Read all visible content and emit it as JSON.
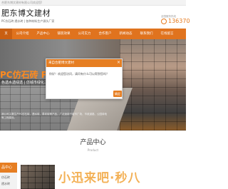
{
  "topbar": {
    "text": "合肥东博文建材有限公司欢迎您!"
  },
  "header": {
    "logo_title": "肥东博文建材",
    "logo_subtitle": "PC仿石砖·透水砖 | 各种材料生产源头厂家",
    "hotline_label": "全国服务热线",
    "phone": "136370"
  },
  "nav": {
    "items": [
      {
        "label": "页"
      },
      {
        "label": "公司介绍"
      },
      {
        "label": "产品中心"
      },
      {
        "label": "铺装效果"
      },
      {
        "label": "公司实力"
      },
      {
        "label": "合作客户"
      },
      {
        "label": "新闻动态"
      },
      {
        "label": "联系我们"
      },
      {
        "label": "在线留言"
      }
    ]
  },
  "banner": {
    "title": "PC仿石砖 PC",
    "subtitle": "色透水透绿透 | 仿城市绿化工程管家",
    "body": "我公司主要生产PC仿石砖，透水砖，草坪砖等产品，广泛适用于城市广场、市政道路、公园绿地等工程建设。"
  },
  "dialog": {
    "title": "来自合肥博文建材",
    "close": "×",
    "message": "你好！欢迎您访问，请问有什么可以帮到您吗？",
    "confirm": "确定"
  },
  "products": {
    "title": "产品中心",
    "subtitle": "Product"
  },
  "categories": {
    "head": "品中心",
    "items": [
      "仿石砖",
      "透水砖"
    ]
  },
  "watermark": "小迅来吧·秒八"
}
